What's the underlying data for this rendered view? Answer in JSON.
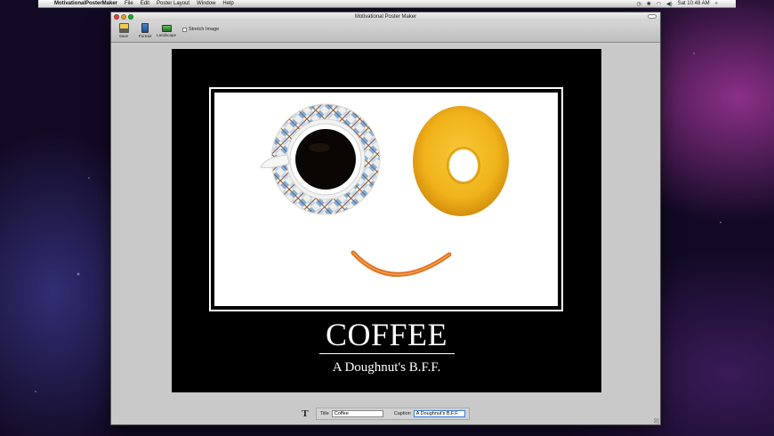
{
  "menubar": {
    "app_name": "MotivationalPosterMaker",
    "items": [
      "File",
      "Edit",
      "Poster Layout",
      "Window",
      "Help"
    ],
    "clock": "Sat 10:48 AM"
  },
  "window": {
    "title": "Motivational Poster Maker"
  },
  "toolbar": {
    "save_label": "Save",
    "portrait_label": "Portrait",
    "landscape_label": "Landscape",
    "stretch_label": "Stretch Image"
  },
  "poster": {
    "title": "COFFEE",
    "caption": "A Doughnut's B.F.F."
  },
  "fields": {
    "title_label": "Title",
    "title_value": "Coffee",
    "caption_label": "Caption",
    "caption_value": "A Doughnut's B.F.F."
  }
}
